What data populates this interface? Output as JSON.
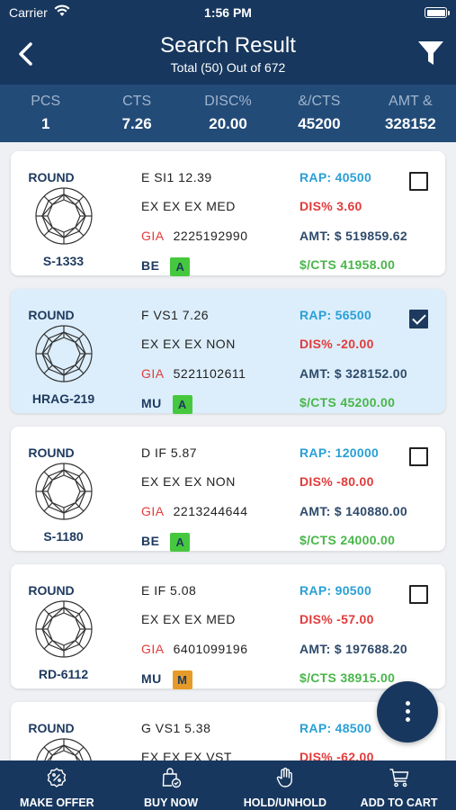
{
  "status_bar": {
    "carrier": "Carrier",
    "time": "1:56 PM"
  },
  "nav": {
    "title": "Search Result",
    "subtitle": "Total (50) Out of 672"
  },
  "summary": [
    {
      "label": "PCS",
      "value": "1"
    },
    {
      "label": "CTS",
      "value": "7.26"
    },
    {
      "label": "DISC%",
      "value": "20.00"
    },
    {
      "label": "&/CTS",
      "value": "45200"
    },
    {
      "label": "AMT &",
      "value": "328152"
    }
  ],
  "items": [
    {
      "shape": "ROUND",
      "line1": "E  SI1  12.39",
      "line2": "EX  EX  EX  MED",
      "gia": "GIA",
      "cert": "2225192990",
      "lab": "BE",
      "badge": "A",
      "badge_color": "#46c83e",
      "stone_id": "S-1333",
      "rap": "RAP: 40500",
      "dis": "DIS% 3.60",
      "amt": "AMT: $ 519859.62",
      "cts": "$/CTS 41958.00",
      "checked": false
    },
    {
      "shape": "ROUND",
      "line1": "F  VS1  7.26",
      "line2": "EX  EX  EX  NON",
      "gia": "GIA",
      "cert": "5221102611",
      "lab": "MU",
      "badge": "A",
      "badge_color": "#46c83e",
      "stone_id": "HRAG-219",
      "rap": "RAP: 56500",
      "dis": "DIS% -20.00",
      "amt": "AMT: $ 328152.00",
      "cts": "$/CTS 45200.00",
      "checked": true
    },
    {
      "shape": "ROUND",
      "line1": "D  IF  5.87",
      "line2": "EX  EX  EX  NON",
      "gia": "GIA",
      "cert": "2213244644",
      "lab": "BE",
      "badge": "A",
      "badge_color": "#46c83e",
      "stone_id": "S-1180",
      "rap": "RAP: 120000",
      "dis": "DIS% -80.00",
      "amt": "AMT: $ 140880.00",
      "cts": "$/CTS 24000.00",
      "checked": false
    },
    {
      "shape": "ROUND",
      "line1": "E  IF  5.08",
      "line2": "EX  EX  EX  MED",
      "gia": "GIA",
      "cert": "6401099196",
      "lab": "MU",
      "badge": "M",
      "badge_color": "#e69b28",
      "stone_id": "RD-6112",
      "rap": "RAP: 90500",
      "dis": "DIS% -57.00",
      "amt": "AMT: $ 197688.20",
      "cts": "$/CTS 38915.00",
      "checked": false
    },
    {
      "shape": "ROUND",
      "line1": "G  VS1  5.38",
      "line2": "EX  EX  EX  VST",
      "gia": "",
      "cert": "",
      "lab": "",
      "badge": "",
      "badge_color": "",
      "stone_id": "",
      "rap": "RAP: 48500",
      "dis": "DIS% -62.00",
      "amt": "",
      "cts": "",
      "checked": false
    }
  ],
  "tabs": [
    {
      "label": "MAKE OFFER",
      "icon": "percent-badge-icon"
    },
    {
      "label": "BUY NOW",
      "icon": "shopping-bag-check-icon"
    },
    {
      "label": "HOLD/UNHOLD",
      "icon": "hand-icon"
    },
    {
      "label": "ADD TO CART",
      "icon": "cart-icon"
    }
  ],
  "colors": {
    "navy": "#17375e",
    "summary_bg": "#234b78",
    "rap": "#2a9fd6",
    "dis": "#e23b3b",
    "cts": "#49b64a",
    "selected_card": "#dceefb"
  }
}
